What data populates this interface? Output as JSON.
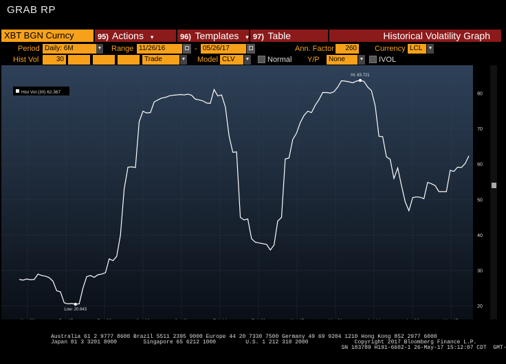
{
  "title": "GRAB RP",
  "toolbar": {
    "ticker": "XBT BGN Curncy",
    "actions": {
      "num": "95)",
      "label": "Actions"
    },
    "templates": {
      "num": "96)",
      "label": "Templates"
    },
    "table": {
      "num": "97)",
      "label": "Table"
    },
    "graph_title": "Historical Volatility Graph"
  },
  "params": {
    "period_label": "Period",
    "period_value": "Daily: 6M",
    "range_label": "Range",
    "range_start": "11/26/16",
    "range_end": "05/26/17",
    "range_sep": "-",
    "ann_label": "Ann. Factor",
    "ann_value": "260",
    "currency_label": "Currency",
    "currency_value": "LCL",
    "histvol_label": "Hist Vol",
    "histvol_value": "30",
    "trade_value": "Trade",
    "model_label": "Model",
    "model_value": "CLV",
    "normal_label": "Normal",
    "yp_label": "Y/P",
    "yp_value": "None",
    "ivol_label": "IVOL"
  },
  "chart_data": {
    "type": "line",
    "legend": "Hist Vol (30) 62.367",
    "series": [
      {
        "name": "Hist Vol (30)",
        "values": [
          27.5,
          27.3,
          27.6,
          27.4,
          27.5,
          29.0,
          28.6,
          28.4,
          28.0,
          27.0,
          24.3,
          24.0,
          20.9,
          20.6,
          20.7,
          20.5,
          20.6,
          25.0,
          28.3,
          28.6,
          28.1,
          28.8,
          29.0,
          29.4,
          33.3,
          32.8,
          34.0,
          40.0,
          53.0,
          59.2,
          59.3,
          59.1,
          72.0,
          75.0,
          74.5,
          74.6,
          77.6,
          78.2,
          78.7,
          78.9,
          79.3,
          79.5,
          79.6,
          79.7,
          79.6,
          79.8,
          79.5,
          78.4,
          78.2,
          77.9,
          77.3,
          77.2,
          81.1,
          79.3,
          79.6,
          76.2,
          68.0,
          63.4,
          63.5,
          45.0,
          44.3,
          44.6,
          39.0,
          38.0,
          37.8,
          37.6,
          37.4,
          35.8,
          37.2,
          44.0,
          45.0,
          61.5,
          61.8,
          67.0,
          68.8,
          71.8,
          73.8,
          75.0,
          74.6,
          76.7,
          78.3,
          80.3,
          80.3,
          80.1,
          80.5,
          81.8,
          83.6,
          83.5,
          83.3,
          83.0,
          83.5,
          83.7,
          83.4,
          81.8,
          80.8,
          76.5,
          67.9,
          67.8,
          62.1,
          61.4,
          56.0,
          59.0,
          54.1,
          49.4,
          46.9,
          50.6,
          50.8,
          50.7,
          50.3,
          54.9,
          54.5,
          54.0,
          52.3,
          52.3,
          52.3,
          58.3,
          58.0,
          59.2,
          59.1,
          60.2,
          62.4
        ]
      }
    ],
    "x_ticks": [
      {
        "label": "Nov 30",
        "year": ""
      },
      {
        "label": "Dec 15",
        "year": "2016"
      },
      {
        "label": "Dec 30",
        "year": ""
      },
      {
        "label": "Jan 16",
        "year": ""
      },
      {
        "label": "Jan 31",
        "year": ""
      },
      {
        "label": "Feb 14",
        "year": ""
      },
      {
        "label": "Feb 28",
        "year": ""
      },
      {
        "label": "Mar 15",
        "year": "2017"
      },
      {
        "label": "Mar 31",
        "year": ""
      },
      {
        "label": "Apr 14",
        "year": ""
      },
      {
        "label": "Apr 28",
        "year": ""
      },
      {
        "label": "May 15",
        "year": ""
      }
    ],
    "y_ticks": [
      20,
      30,
      40,
      50,
      60,
      70,
      80
    ],
    "ylim": [
      17,
      87
    ],
    "hi_label": "Hi: 83.721",
    "low_label": "Low: 20.643",
    "line_color": "#ffffff",
    "background_top": "#2e4158",
    "background_bottom": "#0a0f16"
  },
  "footer": {
    "line1": "Australia 61 2 9777 8600 Brazil 5511 2395 9000 Europe 44 20 7330 7500 Germany 49 69 9204 1210 Hong Kong 852 2977 6000",
    "line2": "Japan 81 3 3201 8900        Singapore 65 6212 1000         U.S. 1 212 318 2000              Copyright 2017 Bloomberg Finance L.P.",
    "line3": "                                                                                        SN 183789 H191-6602-1 26-May-17 15:12:07 CDT  GMT-5:00"
  }
}
